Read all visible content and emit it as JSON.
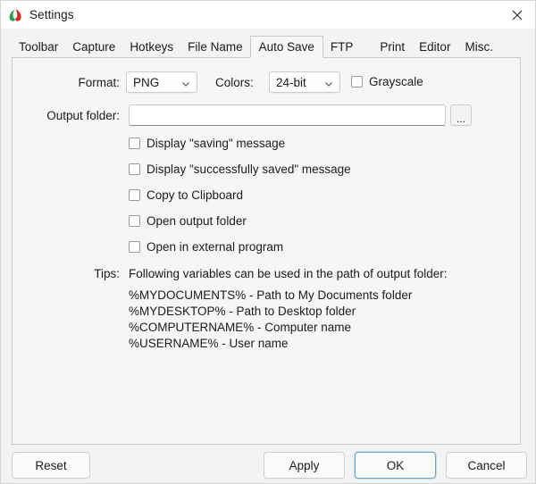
{
  "window": {
    "title": "Settings",
    "app_icon": "faststone-leaf-icon",
    "close_label": "✕"
  },
  "tabs": [
    {
      "label": "Toolbar",
      "selected": false
    },
    {
      "label": "Capture",
      "selected": false
    },
    {
      "label": "Hotkeys",
      "selected": false
    },
    {
      "label": "File Name",
      "selected": false
    },
    {
      "label": "Auto Save",
      "selected": true
    },
    {
      "label": "FTP",
      "selected": false
    },
    {
      "label": "Print",
      "selected": false
    },
    {
      "label": "Editor",
      "selected": false
    },
    {
      "label": "Misc.",
      "selected": false
    }
  ],
  "form": {
    "format_label": "Format:",
    "format_value": "PNG",
    "colors_label": "Colors:",
    "colors_value": "24-bit",
    "grayscale_label": "Grayscale",
    "grayscale_checked": false,
    "output_folder_label": "Output folder:",
    "output_folder_value": "",
    "output_folder_placeholder": "",
    "browse_label": "..."
  },
  "checkboxes": [
    {
      "label": "Display \"saving\" message",
      "checked": false
    },
    {
      "label": "Display \"successfully saved\" message",
      "checked": false
    },
    {
      "label": "Copy to Clipboard",
      "checked": false
    },
    {
      "label": "Open output folder",
      "checked": false
    },
    {
      "label": "Open in external program",
      "checked": false
    }
  ],
  "tips": {
    "label": "Tips:",
    "heading": "Following variables can be used in the path of output folder:",
    "lines": [
      "%MYDOCUMENTS% - Path to My Documents folder",
      "%MYDESKTOP% - Path to Desktop folder",
      "%COMPUTERNAME% - Computer name",
      "%USERNAME% - User name"
    ]
  },
  "footer": {
    "reset_label": "Reset",
    "apply_label": "Apply",
    "ok_label": "OK",
    "cancel_label": "Cancel"
  },
  "colors": {
    "window_bg": "#f3f3f3",
    "panel_bg": "#f6f6f6",
    "titlebar_bg": "#ffffff",
    "text": "#1b1b1b",
    "border": "#c8c8c8",
    "default_button_accent": "#6ba5c9"
  }
}
